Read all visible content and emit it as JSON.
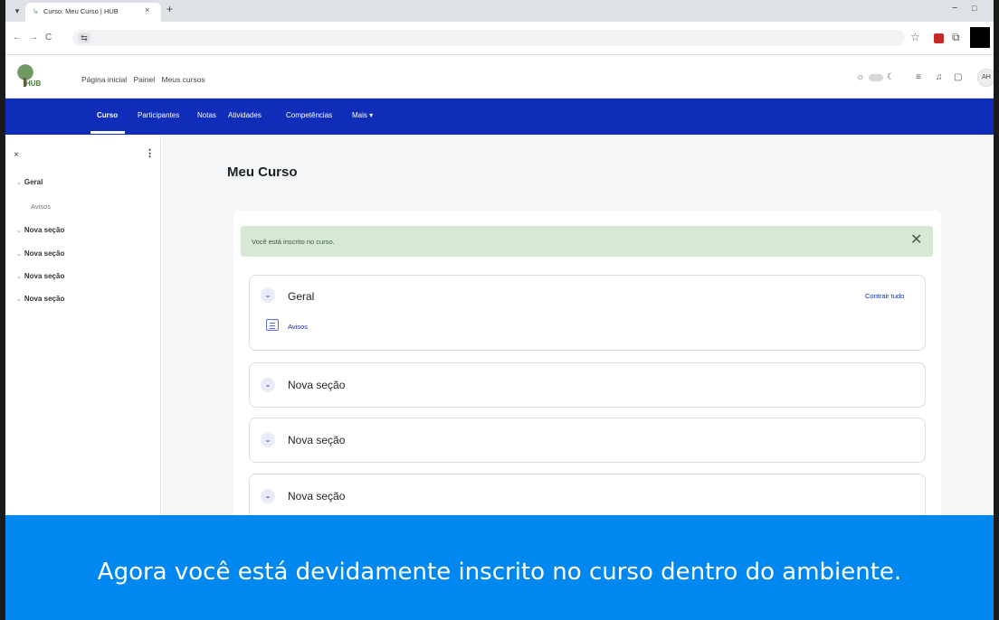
{
  "browser": {
    "tab_title": "Curso: Meu Curso | HUB",
    "tab_close": "×",
    "new_tab": "+",
    "nav_back": "←",
    "nav_forward": "→",
    "nav_reload": "C",
    "window_min": "−",
    "window_max": "□"
  },
  "header": {
    "logo_text": "HUB",
    "nav": [
      "Página inicial",
      "Painel",
      "Meus cursos"
    ],
    "avatar_initials": "AH"
  },
  "course_nav": {
    "items": [
      "Curso",
      "Participantes",
      "Notas",
      "Atividades",
      "Competências",
      "Mais ▾"
    ],
    "active": "Curso"
  },
  "drawer": {
    "close": "×",
    "menu": "⋮",
    "items": [
      {
        "label": "Geral",
        "expanded": true
      },
      {
        "label": "Avisos",
        "child": true
      },
      {
        "label": "Nova seção",
        "expanded": true
      },
      {
        "label": "Nova seção",
        "expanded": true
      },
      {
        "label": "Nova seção",
        "expanded": true
      },
      {
        "label": "Nova seção",
        "expanded": true
      }
    ]
  },
  "main": {
    "title": "Meu Curso",
    "alert": "Você está inscrito no curso.",
    "alert_close": "✕",
    "collapse_all": "Contrair tudo",
    "sections": [
      {
        "title": "Geral",
        "activities": [
          "Avisos"
        ]
      },
      {
        "title": "Nova seção"
      },
      {
        "title": "Nova seção"
      },
      {
        "title": "Nova seção"
      }
    ]
  },
  "caption": "Agora você está devidamente inscrito no curso dentro do ambiente.",
  "colors": {
    "course_nav_bg": "#0f2db8",
    "alert_bg": "#d7e8d5",
    "caption_bg": "#0088f0"
  }
}
